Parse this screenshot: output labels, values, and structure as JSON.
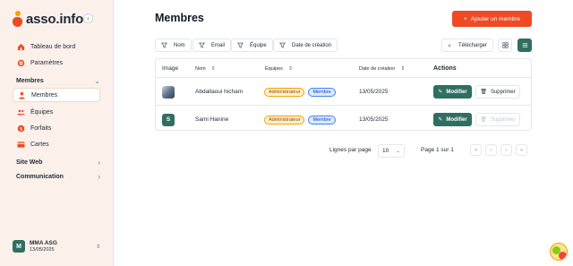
{
  "sidebar": {
    "logo_text": "asso.info",
    "collapse_glyph": "‹",
    "items": [
      {
        "label": "Tableau de bord",
        "icon": "home-icon"
      },
      {
        "label": "Paramètres",
        "icon": "gear-icon"
      }
    ],
    "sections": [
      {
        "label": "Membres",
        "expanded": true
      },
      {
        "label": "Site Web",
        "expanded": false
      },
      {
        "label": "Communication",
        "expanded": false
      }
    ],
    "member_items": [
      {
        "label": "Membres",
        "icon": "user-icon",
        "active": true
      },
      {
        "label": "Équipes",
        "icon": "users-icon"
      },
      {
        "label": "Forfaits",
        "icon": "money-icon"
      },
      {
        "label": "Cartes",
        "icon": "card-icon"
      }
    ],
    "org": {
      "initial": "M",
      "name": "MMA ASG",
      "date": "13/05/2025"
    }
  },
  "main": {
    "title": "Membres",
    "add_button": "Ajouter un membre",
    "filters": [
      "Nom",
      "Email",
      "Équipe",
      "Date de création"
    ],
    "download_button": "Télécharger",
    "table": {
      "headers": [
        "Image",
        "Nom",
        "Équipes",
        "Date de création",
        "Actions"
      ],
      "rows": [
        {
          "avatar": "photo",
          "name": "Abdallaoui hicham",
          "badges": [
            "Administrateur",
            "Membre"
          ],
          "date": "13/05/2025",
          "modify": "Modifier",
          "delete": "Supprimer",
          "delete_enabled": true
        },
        {
          "avatar": "S",
          "name": "Sami Hanine",
          "badges": [
            "Administrateur",
            "Membre"
          ],
          "date": "13/05/2025",
          "modify": "Modifier",
          "delete": "Supprimer",
          "delete_enabled": false
        }
      ]
    },
    "pagination": {
      "rows_label": "Lignes par page",
      "rows_value": "10",
      "page_info": "Page 1 sur 1"
    }
  },
  "colors": {
    "accent": "#ef4a23",
    "primary": "#2f6f62",
    "sidebar_bg": "#fcf1ea"
  }
}
